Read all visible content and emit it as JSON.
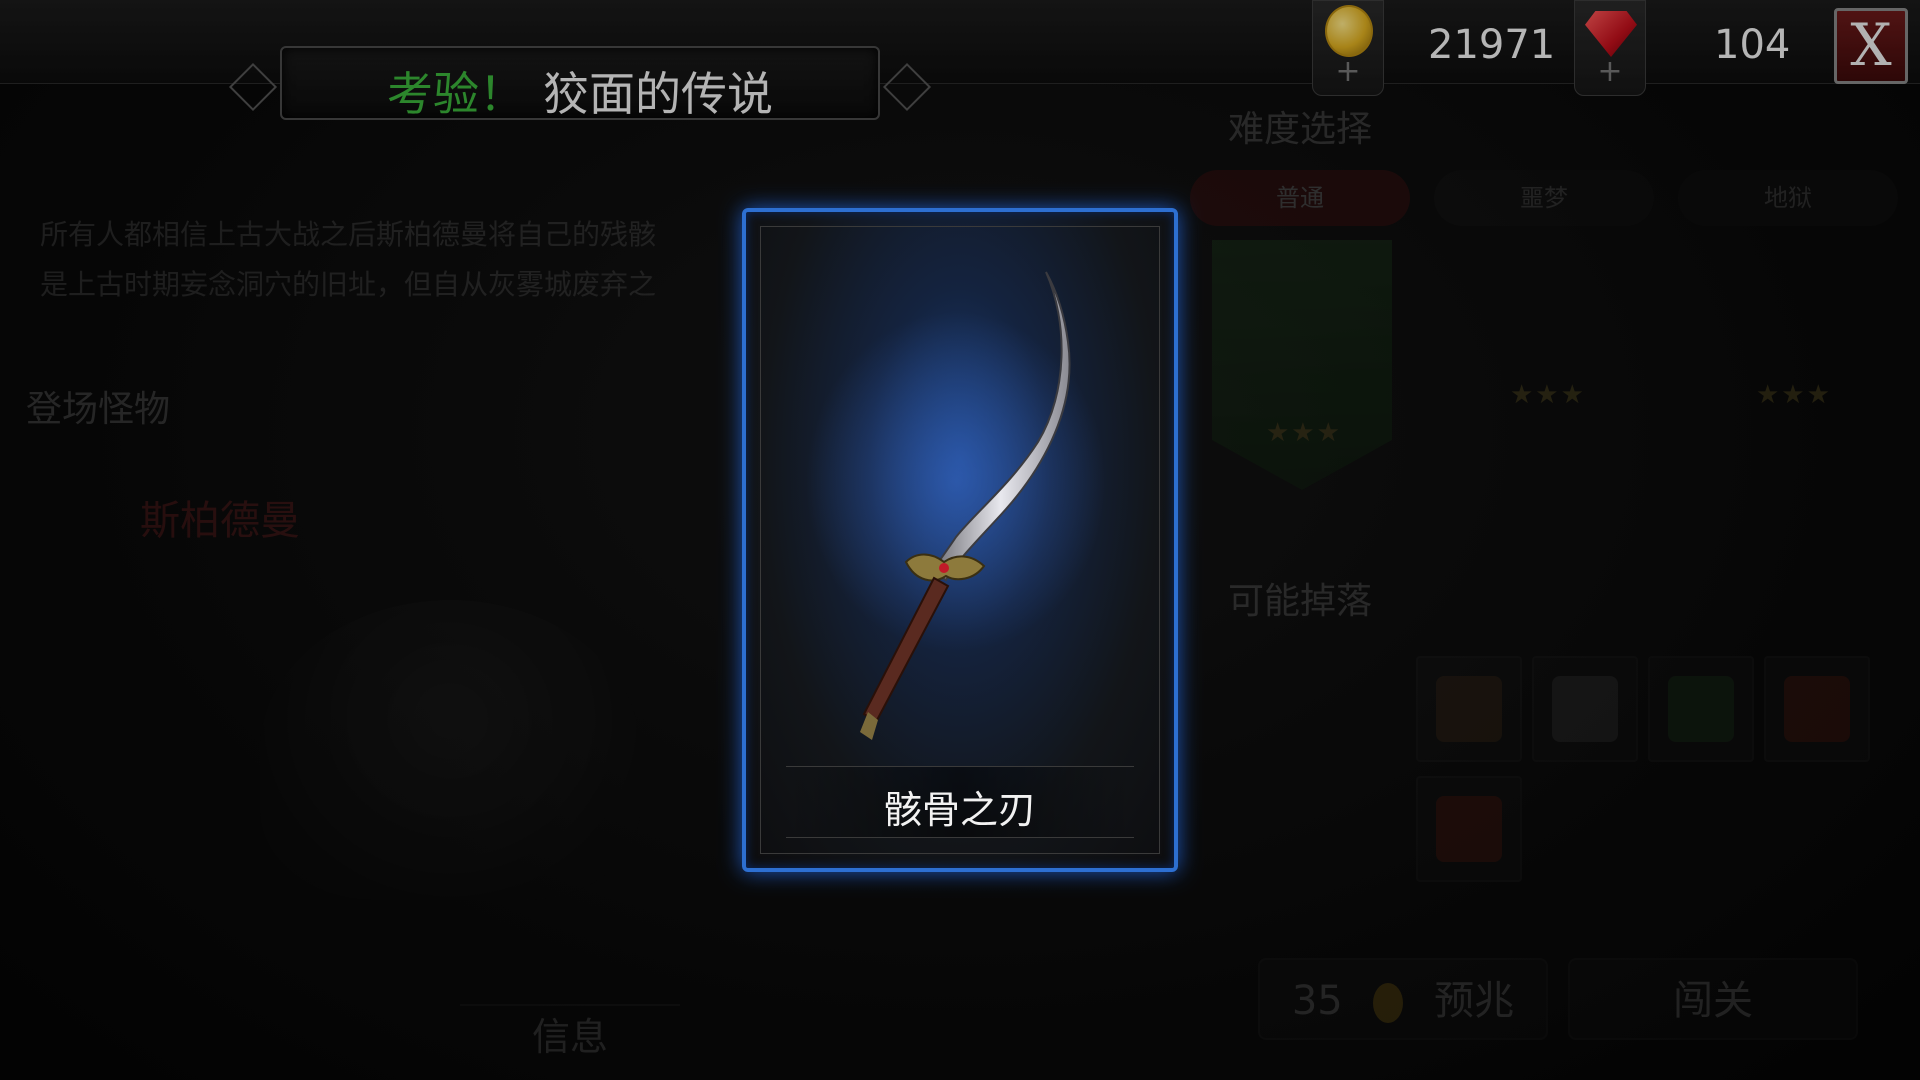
{
  "header": {
    "title_prefix": "考验！",
    "title_main": "狡面的传说"
  },
  "resources": {
    "gold": "21971",
    "gems": "104",
    "add_symbol": "+"
  },
  "close_label": "X",
  "background": {
    "description_line1": "所有人都相信上古大战之后斯柏德曼将自己的残骸",
    "description_line2": "是上古时期妄念洞穴的旧址，但自从灰雾城废弃之",
    "monsters_heading": "登场怪物",
    "monster_name": "斯柏德曼",
    "info_tab": "信息",
    "difficulty_heading": "难度选择",
    "difficulty_tabs": [
      "普通",
      "噩梦",
      "地狱"
    ],
    "stars": "★★★",
    "drops_heading": "可能掉落",
    "cost": "35",
    "omen_label": "预兆",
    "enter_label": "闯关"
  },
  "item_card": {
    "name": "骸骨之刃",
    "icon": "curved-sword-icon"
  },
  "colors": {
    "accent_blue": "#2d6fd1",
    "title_green": "#3bb33b",
    "danger_red": "#d23a3a"
  }
}
